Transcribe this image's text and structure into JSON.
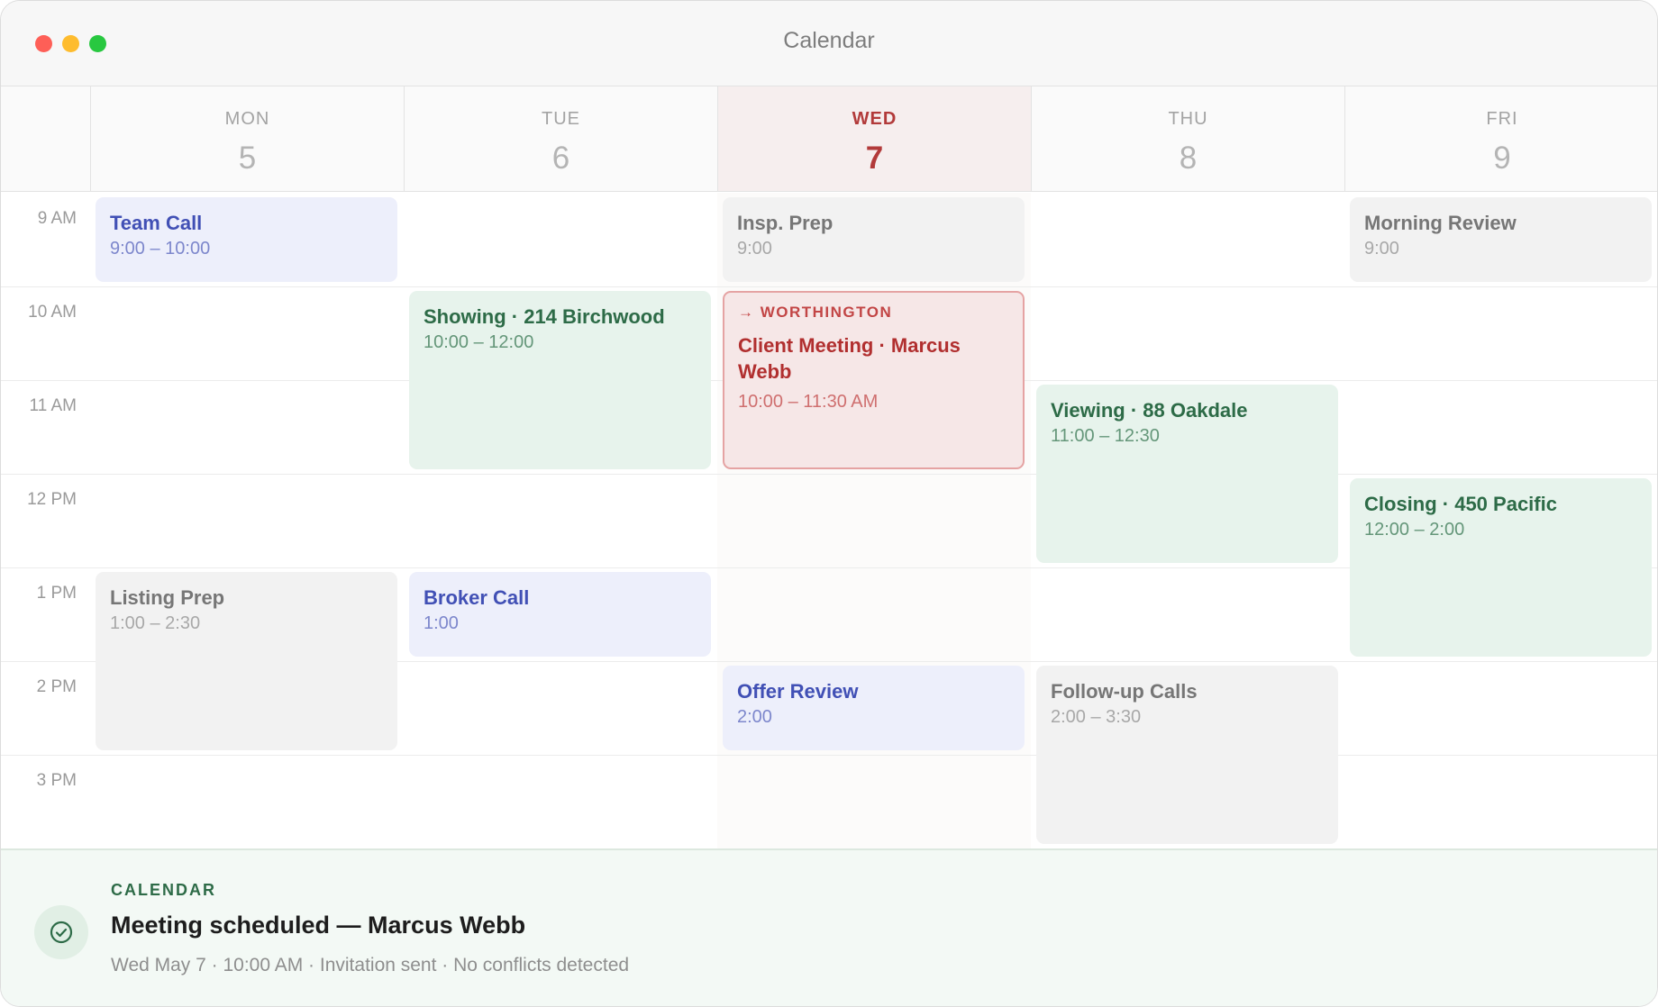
{
  "window": {
    "title": "Calendar"
  },
  "days": [
    {
      "dow": "MON",
      "date": "5"
    },
    {
      "dow": "TUE",
      "date": "6"
    },
    {
      "dow": "WED",
      "date": "7"
    },
    {
      "dow": "THU",
      "date": "8"
    },
    {
      "dow": "FRI",
      "date": "9"
    }
  ],
  "hours": [
    "9 AM",
    "10 AM",
    "11 AM",
    "12 PM",
    "1 PM",
    "2 PM",
    "3 PM"
  ],
  "events": {
    "team_call": {
      "title": "Team Call",
      "time": "9:00 – 10:00"
    },
    "insp_prep": {
      "title": "Insp. Prep",
      "time": "9:00"
    },
    "morning_review": {
      "title": "Morning Review",
      "time": "9:00"
    },
    "showing": {
      "title": "Showing · 214 Birchwood",
      "time": "10:00 – 12:00"
    },
    "client_meeting": {
      "tag": "→ WORTHINGTON",
      "title": "Client Meeting · Marcus Webb",
      "time": "10:00 – 11:30 AM"
    },
    "viewing": {
      "title": "Viewing · 88 Oakdale",
      "time": "11:00 – 12:30"
    },
    "closing": {
      "title": "Closing · 450 Pacific",
      "time": "12:00 – 2:00"
    },
    "listing_prep": {
      "title": "Listing Prep",
      "time": "1:00 – 2:30"
    },
    "broker_call": {
      "title": "Broker Call",
      "time": "1:00"
    },
    "offer_review": {
      "title": "Offer Review",
      "time": "2:00"
    },
    "followup_calls": {
      "title": "Follow-up Calls",
      "time": "2:00 – 3:30"
    }
  },
  "notification": {
    "category": "CALENDAR",
    "headline": "Meeting scheduled — Marcus Webb",
    "detail": "Wed May 7 · 10:00 AM · Invitation sent · No conflicts detected",
    "icon": "check-circle-icon"
  },
  "colors": {
    "today_accent": "#b23a3a",
    "success": "#2d6b47"
  }
}
